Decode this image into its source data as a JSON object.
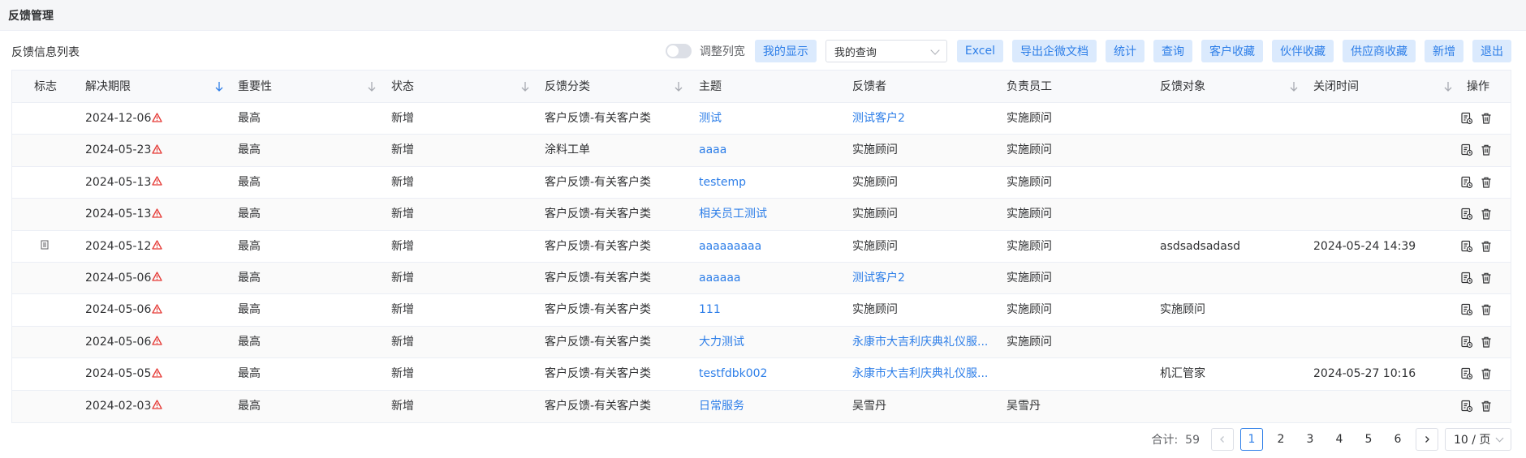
{
  "page_title": "反馈管理",
  "list_title": "反馈信息列表",
  "toolbar": {
    "toggle_label": "调整列宽",
    "my_display": "我的显示",
    "query_select": "我的查询",
    "buttons": [
      "Excel",
      "导出企微文档",
      "统计",
      "查询",
      "客户收藏",
      "伙伴收藏",
      "供应商收藏",
      "新增",
      "退出"
    ]
  },
  "columns": [
    "标志",
    "解决期限",
    "重要性",
    "状态",
    "反馈分类",
    "主题",
    "反馈者",
    "负责员工",
    "反馈对象",
    "关闭时间",
    "操作"
  ],
  "rows": [
    {
      "flag": "",
      "deadline": "2024-12-06",
      "importance": "最高",
      "status": "新增",
      "category": "客户反馈-有关客户类",
      "subject": "测试",
      "feedbacker": "测试客户2",
      "feedbacker_link": true,
      "staff": "实施顾问",
      "target": "",
      "closed": ""
    },
    {
      "flag": "",
      "deadline": "2024-05-23",
      "importance": "最高",
      "status": "新增",
      "category": "涂料工单",
      "subject": "aaaa",
      "feedbacker": "实施顾问",
      "feedbacker_link": false,
      "staff": "实施顾问",
      "target": "",
      "closed": ""
    },
    {
      "flag": "",
      "deadline": "2024-05-13",
      "importance": "最高",
      "status": "新增",
      "category": "客户反馈-有关客户类",
      "subject": "testemp",
      "feedbacker": "实施顾问",
      "feedbacker_link": false,
      "staff": "实施顾问",
      "target": "",
      "closed": ""
    },
    {
      "flag": "",
      "deadline": "2024-05-13",
      "importance": "最高",
      "status": "新增",
      "category": "客户反馈-有关客户类",
      "subject": "相关员工测试",
      "feedbacker": "实施顾问",
      "feedbacker_link": false,
      "staff": "实施顾问",
      "target": "",
      "closed": ""
    },
    {
      "flag": "doc",
      "deadline": "2024-05-12",
      "importance": "最高",
      "status": "新增",
      "category": "客户反馈-有关客户类",
      "subject": "aaaaaaaaa",
      "feedbacker": "实施顾问",
      "feedbacker_link": false,
      "staff": "实施顾问",
      "target": "asdsadsadasd",
      "closed": "2024-05-24 14:39"
    },
    {
      "flag": "",
      "deadline": "2024-05-06",
      "importance": "最高",
      "status": "新增",
      "category": "客户反馈-有关客户类",
      "subject": "aaaaaa",
      "feedbacker": "测试客户2",
      "feedbacker_link": true,
      "staff": "实施顾问",
      "target": "",
      "closed": ""
    },
    {
      "flag": "",
      "deadline": "2024-05-06",
      "importance": "最高",
      "status": "新增",
      "category": "客户反馈-有关客户类",
      "subject": "111",
      "feedbacker": "实施顾问",
      "feedbacker_link": false,
      "staff": "实施顾问",
      "target": "实施顾问",
      "closed": ""
    },
    {
      "flag": "",
      "deadline": "2024-05-06",
      "importance": "最高",
      "status": "新增",
      "category": "客户反馈-有关客户类",
      "subject": "大力测试",
      "feedbacker": "永康市大吉利庆典礼仪服...",
      "feedbacker_link": true,
      "staff": "实施顾问",
      "target": "",
      "closed": ""
    },
    {
      "flag": "",
      "deadline": "2024-05-05",
      "importance": "最高",
      "status": "新增",
      "category": "客户反馈-有关客户类",
      "subject": "testfdbk002",
      "feedbacker": "永康市大吉利庆典礼仪服...",
      "feedbacker_link": true,
      "staff": "",
      "target": "机汇管家",
      "closed": "2024-05-27 10:16"
    },
    {
      "flag": "",
      "deadline": "2024-02-03",
      "importance": "最高",
      "status": "新增",
      "category": "客户反馈-有关客户类",
      "subject": "日常服务",
      "feedbacker": "吴雪丹",
      "feedbacker_link": false,
      "staff": "吴雪丹",
      "target": "",
      "closed": ""
    }
  ],
  "pagination": {
    "total_label": "合计:",
    "total": "59",
    "pages": [
      "1",
      "2",
      "3",
      "4",
      "5",
      "6"
    ],
    "current": "1",
    "page_size": "10 / 页"
  },
  "colors": {
    "accent": "#2d7ee8",
    "warn": "#e53935",
    "button_bg": "#dbeafd"
  }
}
